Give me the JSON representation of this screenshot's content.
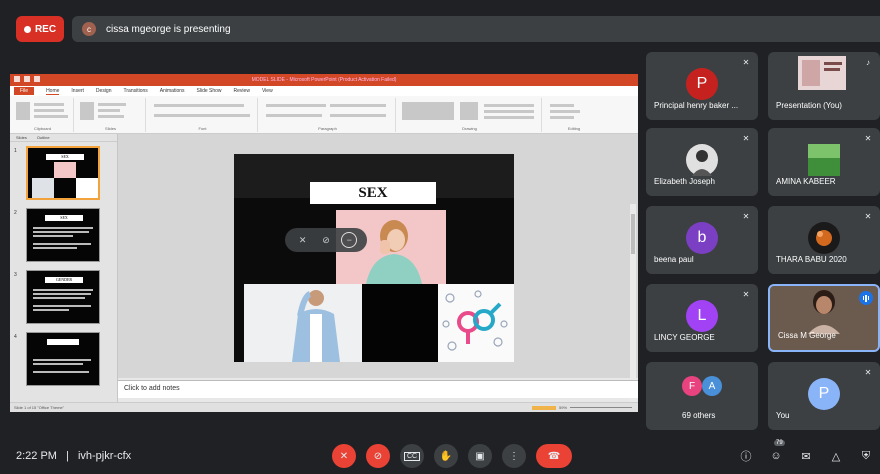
{
  "top": {
    "rec_label": "REC",
    "presenter_initial": "c",
    "presenting_text": "cissa mgeorge is presenting"
  },
  "ppt": {
    "window_title": "MODEL SLIDE - Microsoft PowerPoint (Product Activation Failed)",
    "tabs": [
      "File",
      "Home",
      "Insert",
      "Design",
      "Transitions",
      "Animations",
      "Slide Show",
      "Review",
      "View"
    ],
    "ribbon_groups": [
      "Clipboard",
      "Slides",
      "Font",
      "Paragraph",
      "Drawing",
      "Editing"
    ],
    "thumb_tabs": [
      "Slides",
      "Outline"
    ],
    "thumbnails": [
      {
        "num": "1",
        "title": "SEX"
      },
      {
        "num": "2",
        "title": "SEX"
      },
      {
        "num": "3",
        "title": "GENDER"
      },
      {
        "num": "4",
        "title": ""
      }
    ],
    "slide_title": "SEX",
    "notes_placeholder": "Click to add notes",
    "status_text": "Slide 1 of 15   \"Office Theme\"",
    "zoom_text": "59%"
  },
  "tiles": [
    {
      "name": "Principal henry baker ...",
      "initial": "P",
      "color": "#c5221f",
      "muted": true
    },
    {
      "name": "Presentation (You)",
      "initial": "",
      "color": "",
      "muted": false
    },
    {
      "name": "Elizabeth Joseph",
      "initial": "",
      "color": "",
      "muted": true
    },
    {
      "name": "AMINA KABEER",
      "initial": "",
      "color": "",
      "muted": true
    },
    {
      "name": "beena paul",
      "initial": "b",
      "color": "#7b3fc4",
      "muted": true
    },
    {
      "name": "THARA BABU 2020",
      "initial": "",
      "color": "",
      "muted": true
    },
    {
      "name": "LINCY GEORGE",
      "initial": "L",
      "color": "#a142f4",
      "muted": true
    },
    {
      "name": "Cissa M George",
      "initial": "",
      "color": "",
      "muted": false
    },
    {
      "name": "69 others",
      "initial": "F",
      "initial2": "A",
      "muted": false
    },
    {
      "name": "You",
      "initial": "P",
      "color": "#8ab4f8",
      "muted": true
    }
  ],
  "bottom": {
    "time": "2:22 PM",
    "separator": "|",
    "meeting_code": "ivh-pjkr-cfx",
    "people_count": "79"
  },
  "icons": {
    "mic_off": "mic-off-icon",
    "cam_off": "camera-off-icon",
    "captions": "captions-icon",
    "hand": "raise-hand-icon",
    "present": "present-icon",
    "more": "more-icon",
    "end": "end-call-icon",
    "info": "info-icon",
    "people": "people-icon",
    "chat": "chat-icon",
    "activities": "activities-icon",
    "host": "host-controls-icon"
  }
}
